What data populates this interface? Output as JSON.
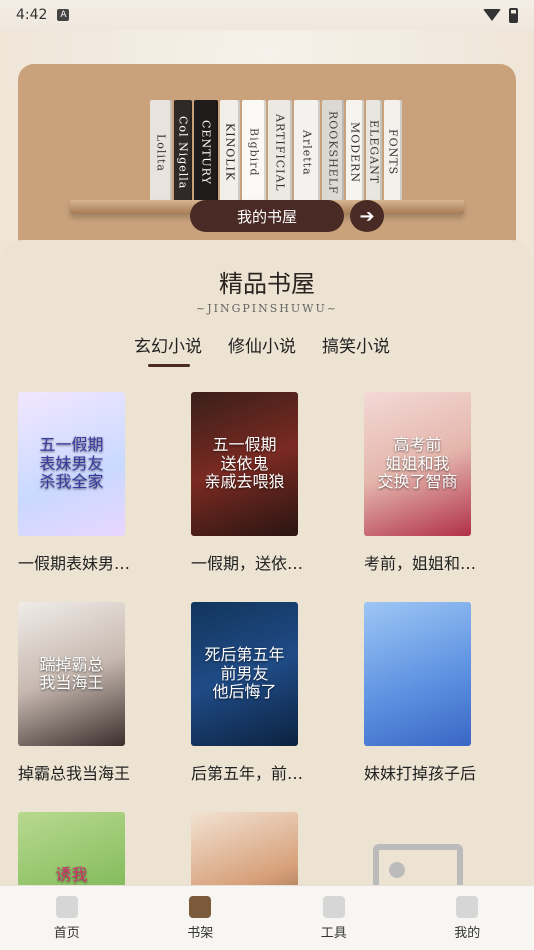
{
  "status_bar": {
    "time": "4:42",
    "notif_glyph": "A"
  },
  "shelf": {
    "books": [
      {
        "label": "Lolita",
        "bg": "#e8e3dc",
        "fg": "#333",
        "w": 22
      },
      {
        "label": "Col Nigella",
        "bg": "#2f2a28",
        "fg": "#fff",
        "w": 18
      },
      {
        "label": "CENTURY",
        "bg": "#1f1c1b",
        "fg": "#fff",
        "w": 24
      },
      {
        "label": "KINOLIK",
        "bg": "#f2efea",
        "fg": "#222",
        "w": 20
      },
      {
        "label": "Bigbird",
        "bg": "#fbf9f6",
        "fg": "#444",
        "w": 24
      },
      {
        "label": "ARTIFICIAL",
        "bg": "#ece8e2",
        "fg": "#333",
        "w": 24
      },
      {
        "label": "Arletta",
        "bg": "#f4f2ee",
        "fg": "#333",
        "w": 26
      },
      {
        "label": "ROOKSHELF",
        "bg": "#dcd8d2",
        "fg": "#444",
        "w": 22
      },
      {
        "label": "MODERN",
        "bg": "#f7f4ef",
        "fg": "#333",
        "w": 18
      },
      {
        "label": "ELEGANT",
        "bg": "#e9e5df",
        "fg": "#333",
        "w": 16
      },
      {
        "label": "FONTS",
        "bg": "#f4f1ec",
        "fg": "#333",
        "w": 18
      }
    ],
    "my_shelf_label": "我的书屋",
    "arrow_glyph": "➔"
  },
  "section": {
    "title": "精品书屋",
    "subtitle": "~JINGPINSHUWU~",
    "tabs": [
      {
        "label": "玄幻小说",
        "active": true
      },
      {
        "label": "修仙小说",
        "active": false
      },
      {
        "label": "搞笑小说",
        "active": false
      }
    ]
  },
  "books": [
    {
      "title": "一假期表妹男…",
      "cover_text": "五一假期\n表妹男友\n杀我全家",
      "cover_bg": "linear-gradient(160deg,#f2e6ff,#c9d9ff 60%,#e8d6ff)",
      "cover_fg": "#3a3aa0"
    },
    {
      "title": "一假期，送依…",
      "cover_text": "五一假期\n送依鬼\n亲戚去喂狼",
      "cover_bg": "linear-gradient(160deg,#3a1f1a,#7a2a22 50%,#2a1512)",
      "cover_fg": "#ffffff"
    },
    {
      "title": "考前，姐姐和…",
      "cover_text": "高考前\n姐姐和我\n交换了智商",
      "cover_bg": "linear-gradient(160deg,#f4d9d6,#e4b6ac 50%,#b1304a)",
      "cover_fg": "#ffffff"
    },
    {
      "title": "掉霸总我当海王",
      "cover_text": "踹掉霸总\n我当海王",
      "cover_bg": "linear-gradient(160deg,#f0ece8,#c7b9b0 50%,#3a2e2c)",
      "cover_fg": "#ffffff"
    },
    {
      "title": "后第五年，前…",
      "cover_text": "死后第五年\n前男友\n他后悔了",
      "cover_bg": "linear-gradient(160deg,#12355c,#1f4b86 50%,#0c2240)",
      "cover_fg": "#ffffff"
    },
    {
      "title": "妹妹打掉孩子后",
      "cover_text": "",
      "cover_bg": "linear-gradient(160deg,#9ec6f5,#5a8fe0 60%,#3a66c4)",
      "cover_fg": "#ffffff"
    },
    {
      "title": "",
      "cover_text": "诱我\n入怀",
      "cover_bg": "linear-gradient(160deg,#b8d98f,#86bd5f 60%,#f0d2d8)",
      "cover_fg": "#d0346a"
    },
    {
      "title": "",
      "cover_text": "",
      "cover_bg": "linear-gradient(160deg,#f2e2d2,#d7a07a 50%,#5a3a2a)",
      "cover_fg": "#ffffff"
    },
    {
      "title": "",
      "cover_text": "",
      "cover_bg": "placeholder",
      "cover_fg": "#bbb"
    }
  ],
  "bottom_nav": [
    {
      "label": "首页",
      "icon": "home-icon",
      "active": false
    },
    {
      "label": "书架",
      "icon": "bookshelf-icon",
      "active": true
    },
    {
      "label": "工具",
      "icon": "tools-icon",
      "active": false
    },
    {
      "label": "我的",
      "icon": "profile-icon",
      "active": false
    }
  ]
}
